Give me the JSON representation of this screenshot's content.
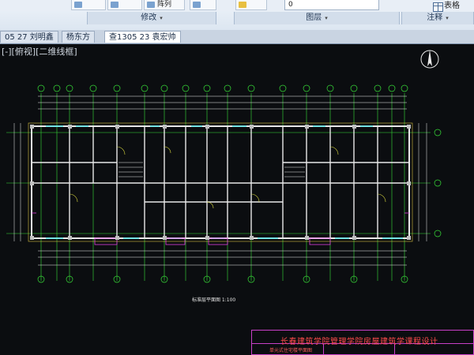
{
  "ribbon": {
    "panels": [
      {
        "label": "修改",
        "dropdown": "▾"
      },
      {
        "label": "图层",
        "dropdown": "▾"
      },
      {
        "label": "注释",
        "dropdown": "▾"
      }
    ],
    "table_button": "表格",
    "partial_buttons": [
      "阵列"
    ],
    "layer_combo_value": "0"
  },
  "tabs": [
    {
      "label": "05 27 刘明鑫",
      "active": false
    },
    {
      "label": "杨东方",
      "active": false
    },
    {
      "label": "查1305 23 袁宏帅",
      "active": true
    }
  ],
  "viewport": {
    "label": "[-][俯视][二维线框]"
  },
  "drawing": {
    "plan_title": "标准层平面图 1:100",
    "title_block": {
      "title": "长春建筑学院管理学院房屋建筑学课程设计",
      "subtitle": "单元式住宅楼平面图"
    },
    "colors": {
      "background": "#0b0d10",
      "grid_axis": "#38e038",
      "wall": "#e8e8e8",
      "dimension": "#f0f0f0",
      "column": "#c0c0c0",
      "window": "#00e0e0",
      "door": "#e0e040",
      "balcony": "#e040e0",
      "title_text": "#ff4b4b"
    }
  }
}
